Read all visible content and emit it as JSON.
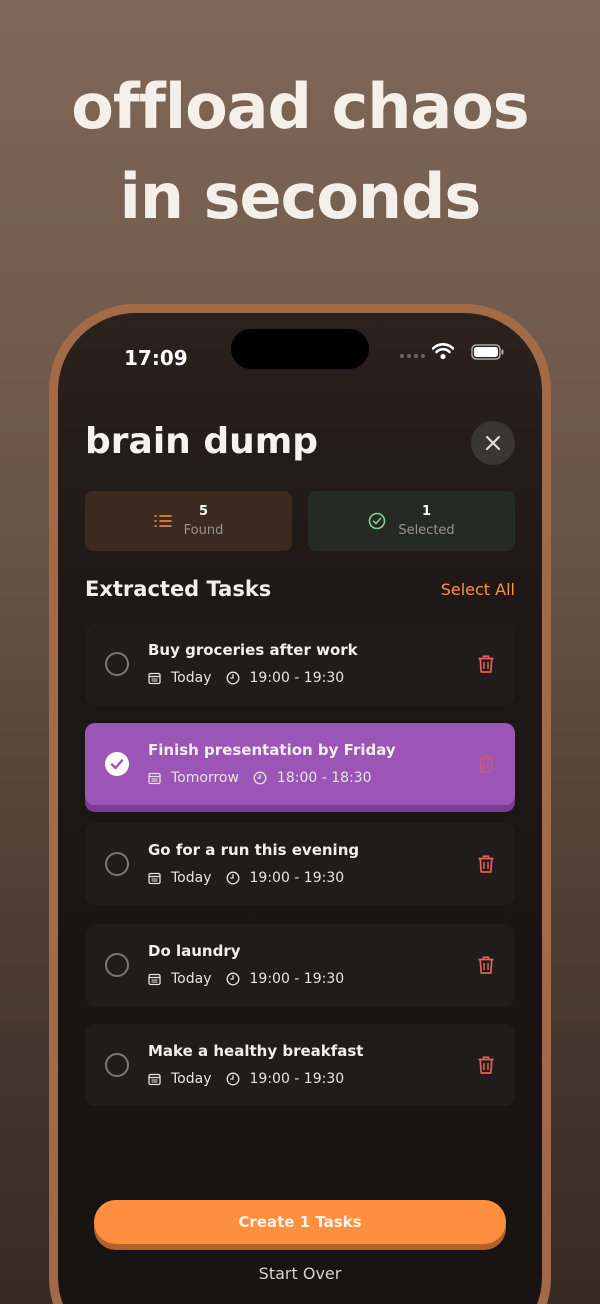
{
  "promo": {
    "line1": "offload chaos",
    "line2": "in seconds"
  },
  "status_bar": {
    "time": "17:09"
  },
  "header": {
    "title": "brain dump",
    "close_icon": "close-icon"
  },
  "stats": {
    "found_count": "5",
    "found_label": "Found",
    "selected_count": "1",
    "selected_label": "Selected"
  },
  "section": {
    "title": "Extracted Tasks",
    "select_all": "Select All"
  },
  "tasks": [
    {
      "title": "Buy groceries after work",
      "date": "Today",
      "time": "19:00 - 19:30",
      "selected": false
    },
    {
      "title": "Finish presentation by Friday",
      "date": "Tomorrow",
      "time": "18:00 - 18:30",
      "selected": true
    },
    {
      "title": "Go for a run this evening",
      "date": "Today",
      "time": "19:00 - 19:30",
      "selected": false
    },
    {
      "title": "Do laundry",
      "date": "Today",
      "time": "19:00 - 19:30",
      "selected": false
    },
    {
      "title": "Make a healthy breakfast",
      "date": "Today",
      "time": "19:00 - 19:30",
      "selected": false
    }
  ],
  "actions": {
    "create": "Create 1 Tasks",
    "start_over": "Start Over"
  },
  "colors": {
    "accent": "#ff8e3f",
    "selected_task": "#9b55b6",
    "trash": "#e85c57"
  }
}
